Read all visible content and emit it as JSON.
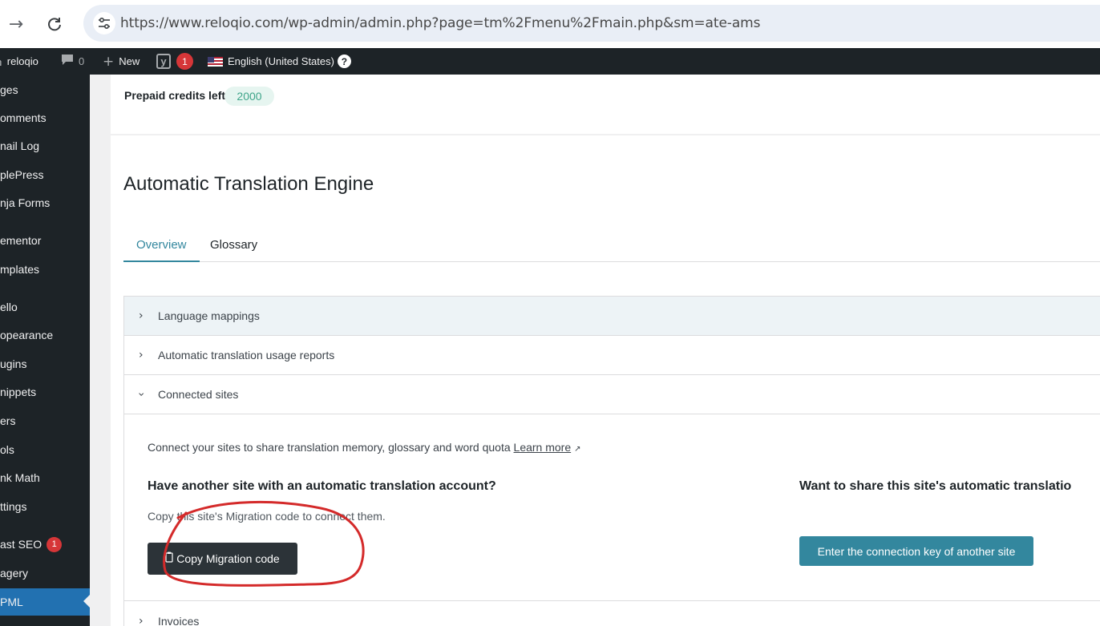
{
  "browser": {
    "url": "https://www.reloqio.com/wp-admin/admin.php?page=tm%2Fmenu%2Fmain.php&sm=ate-ams",
    "forward_icon": "arrow-forward-icon",
    "reload_icon": "reload-icon",
    "site_info_icon": "tune-icon"
  },
  "admin_bar": {
    "site_name": "reloqio",
    "comments_count": "0",
    "new_label": "New",
    "yoast_count": "1",
    "language": "English (United States)",
    "help_glyph": "?"
  },
  "sidebar": {
    "items": [
      {
        "label": "ges"
      },
      {
        "label": "omments"
      },
      {
        "label": "nail Log"
      },
      {
        "label": "plePress"
      },
      {
        "label": "nja Forms"
      },
      {
        "label": "ementor"
      },
      {
        "label": "mplates"
      },
      {
        "label": "ello"
      },
      {
        "label": "opearance"
      },
      {
        "label": "ugins"
      },
      {
        "label": "nippets"
      },
      {
        "label": "ers"
      },
      {
        "label": "ols"
      },
      {
        "label": "nk Math"
      },
      {
        "label": "ttings"
      },
      {
        "label": "ast SEO",
        "badge": "1"
      },
      {
        "label": "agery"
      },
      {
        "label": "PML"
      }
    ]
  },
  "credits": {
    "label": "Prepaid credits left",
    "value": "2000"
  },
  "page": {
    "title": "Automatic Translation Engine",
    "tabs": [
      "Overview",
      "Glossary"
    ]
  },
  "accordion": {
    "language_mappings": "Language mappings",
    "usage_reports": "Automatic translation usage reports",
    "connected_sites": "Connected sites",
    "invoices": "Invoices"
  },
  "connected": {
    "description": "Connect your sites to share translation memory, glossary and word quota",
    "learn_more": "Learn more",
    "left_heading": "Have another site with an automatic translation account?",
    "left_sub": "Copy this site's Migration code to connect them.",
    "copy_button": "Copy Migration code",
    "right_heading": "Want to share this site's automatic translatio",
    "connect_button": "Enter the connection key of another site"
  },
  "colors": {
    "admin_dark": "#1d2327",
    "active_menu": "#2271b1",
    "accent_teal": "#33879e",
    "annotation_red": "#d42a2a"
  }
}
